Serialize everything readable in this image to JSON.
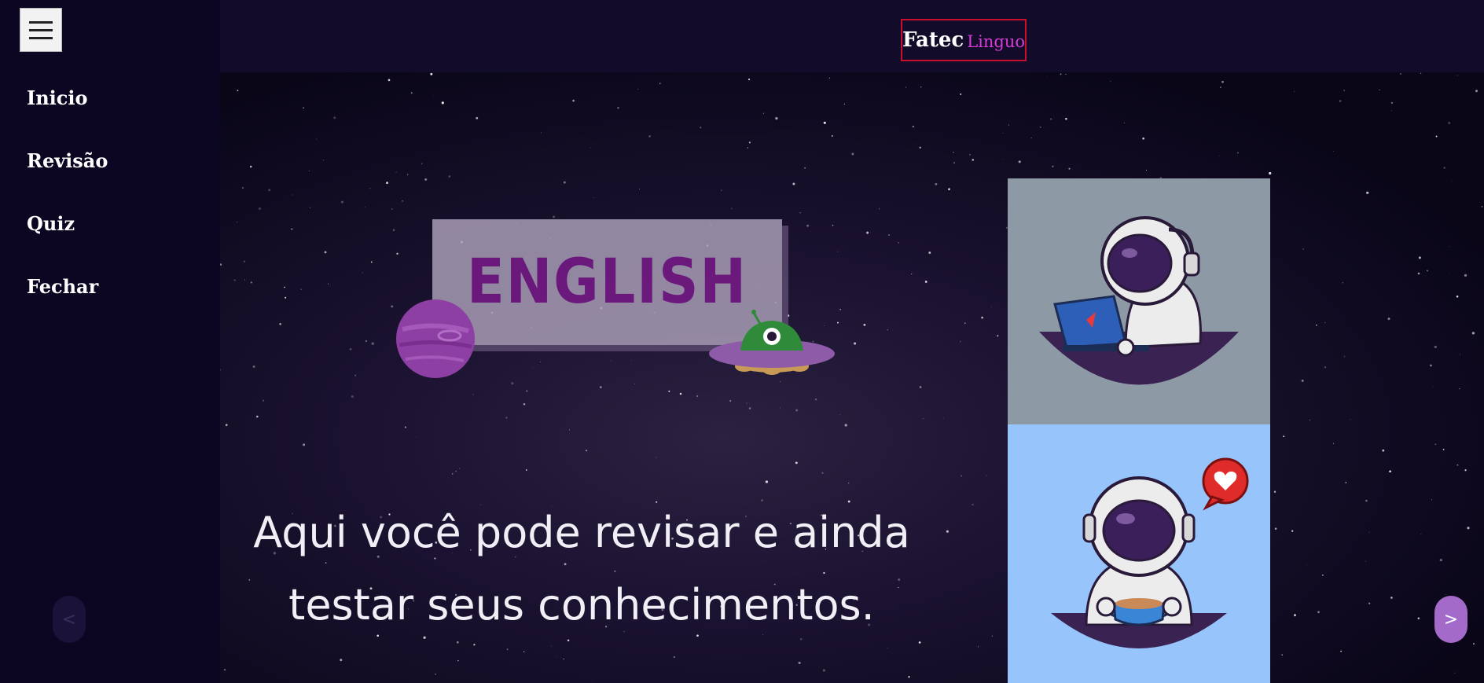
{
  "header": {
    "logo_primary": "Fatec",
    "logo_secondary": "Linguo"
  },
  "sidebar": {
    "items": [
      {
        "label": "Inicio"
      },
      {
        "label": "Revisão"
      },
      {
        "label": "Quiz"
      },
      {
        "label": "Fechar"
      }
    ]
  },
  "hero": {
    "banner_text": "ENGLISH",
    "tagline_line1": "Aqui você pode revisar e ainda",
    "tagline_line2": "testar seus conhecimentos."
  },
  "carousel": {
    "prev_label": "<",
    "next_label": ">"
  },
  "colors": {
    "sidebar_bg": "#0c0622",
    "topbar_bg": "#120c2a",
    "logo_border": "#c8102e",
    "logo_accent": "#d63bd8",
    "next_button": "#a36ac9"
  },
  "icons": {
    "menu": "hamburger-icon",
    "planet": "planet-icon",
    "ufo": "ufo-icon",
    "astronaut_laptop": "astronaut-laptop-illustration",
    "astronaut_coffee": "astronaut-coffee-illustration",
    "heart_bubble": "heart-bubble-icon"
  }
}
